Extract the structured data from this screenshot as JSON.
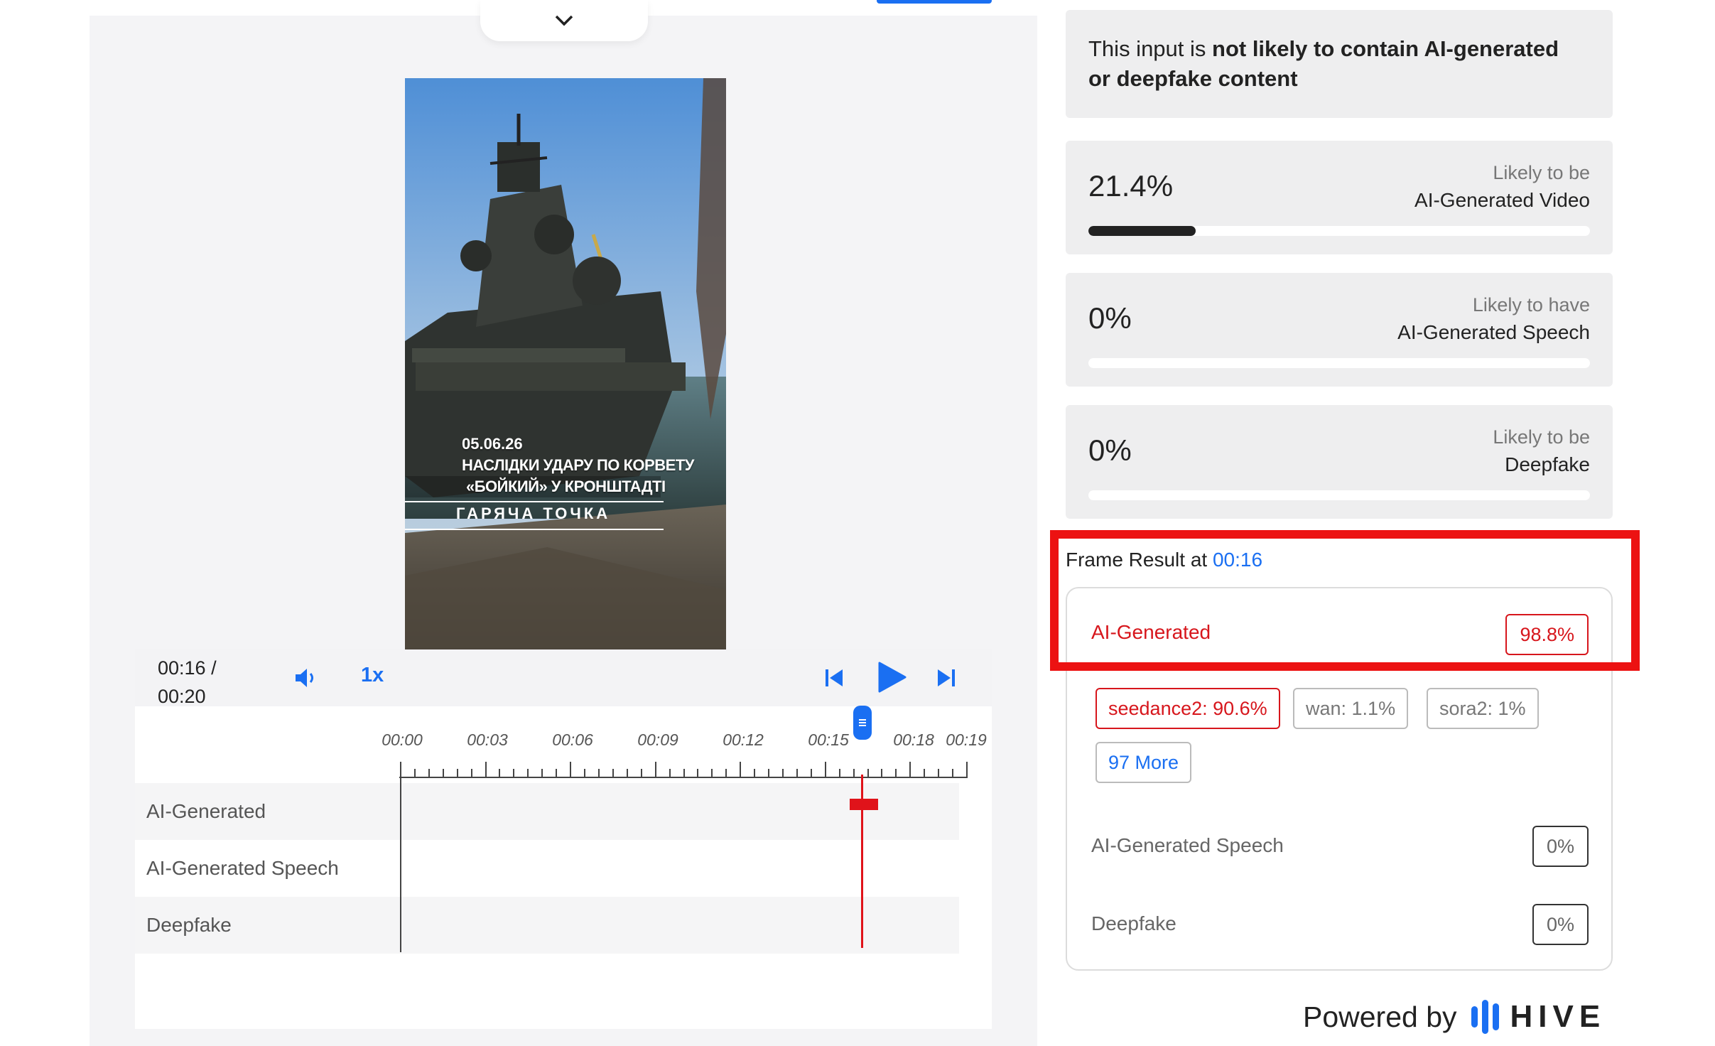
{
  "player": {
    "current_time": "00:16 /",
    "duration": "00:20",
    "speed": "1x",
    "video_overlay": {
      "date": "05.06.26",
      "line1": "НАСЛІДКИ УДАРУ ПО КОРВЕТУ",
      "line2": "«БОЙКИЙ» У КРОНШТАДТІ",
      "channel": "ГАРЯЧА ТОЧКА"
    },
    "progress": 0.8
  },
  "timeline": {
    "ticks": [
      "00:00",
      "00:03",
      "00:06",
      "00:09",
      "00:12",
      "00:15",
      "00:18",
      "00:19"
    ],
    "rows": [
      "AI-Generated",
      "AI-Generated Speech",
      "Deepfake"
    ]
  },
  "summary": {
    "prefix": "This input is ",
    "emphasis": "not likely to contain AI-generated or deepfake content"
  },
  "stats": [
    {
      "value": "21.4%",
      "line1": "Likely to be",
      "line2": "AI-Generated Video",
      "fraction": 0.214
    },
    {
      "value": "0%",
      "line1": "Likely to have",
      "line2": "AI-Generated Speech",
      "fraction": 0
    },
    {
      "value": "0%",
      "line1": "Likely to be",
      "line2": "Deepfake",
      "fraction": 0
    }
  ],
  "frame_result": {
    "title": "Frame Result at ",
    "timestamp": "00:16",
    "ai_label": "AI-Generated",
    "ai_value": "98.8%",
    "chips": [
      "seedance2: 90.6%",
      "wan: 1.1%",
      "sora2: 1%"
    ],
    "more": "97 More",
    "speech_label": "AI-Generated Speech",
    "speech_value": "0%",
    "deepfake_label": "Deepfake",
    "deepfake_value": "0%"
  },
  "footer": {
    "powered_by": "Powered by",
    "brand": "HIVE"
  },
  "colors": {
    "accent": "#1a6ff2",
    "alert": "#d7161c",
    "highlight_box": "#ec1212"
  }
}
